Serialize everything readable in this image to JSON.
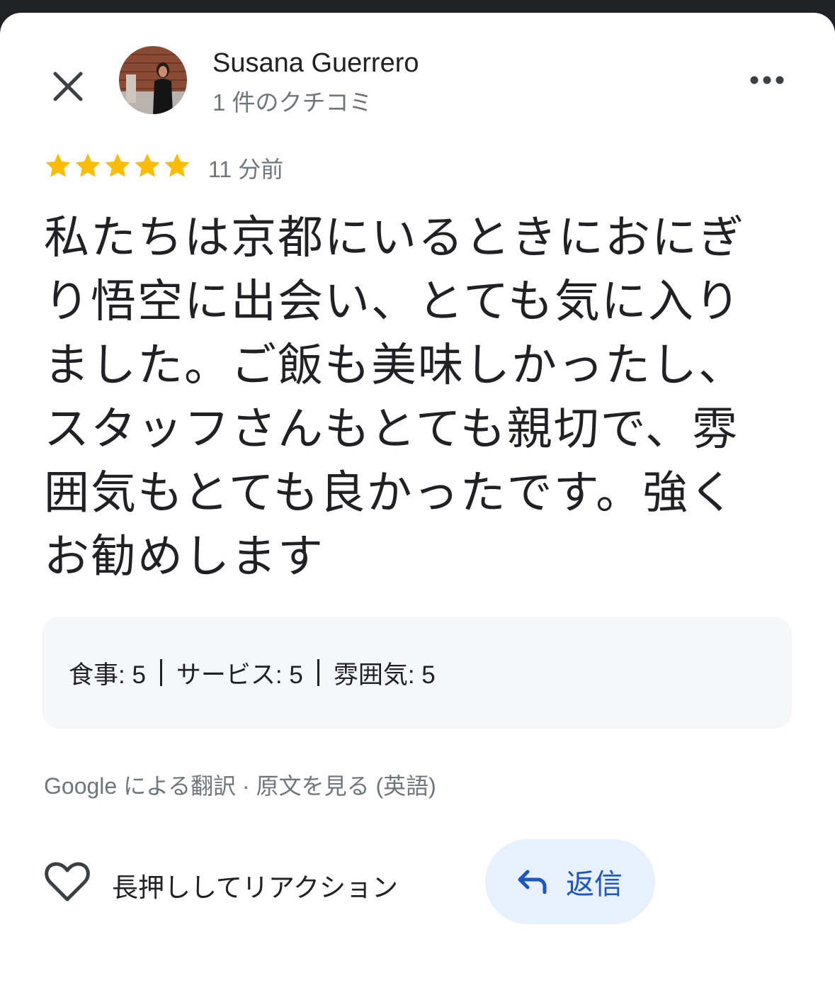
{
  "colors": {
    "star": "#fbbc04",
    "accent": "#1a56c4",
    "reply_bg": "#e8f0fe",
    "ratings_bg": "#f6f7f8"
  },
  "header": {
    "close_icon": "close-icon",
    "author_name": "Susana Guerrero",
    "review_count": "1 件のクチコミ",
    "more_icon": "more-horizontal-icon"
  },
  "review": {
    "rating": 5,
    "max_rating": 5,
    "time_ago": "11 分前",
    "text": "私たちは京都にいるときにおにぎり悟空に出会い、とても気に入りました。ご飯も美味しかったし、スタッフさんもとても親切で、雰囲気もとても良かったです。強くお勧めします"
  },
  "ratings": [
    {
      "label": "食事: 5"
    },
    {
      "label": "サービス: 5"
    },
    {
      "label": "雰囲気: 5"
    }
  ],
  "translation": {
    "prefix": "Google による翻訳",
    "dot": " · ",
    "link": "原文を見る (英語)"
  },
  "actions": {
    "heart_icon": "heart-outline-icon",
    "reaction_label": "長押ししてリアクション",
    "reply_icon": "reply-arrow-icon",
    "reply_label": "返信"
  }
}
